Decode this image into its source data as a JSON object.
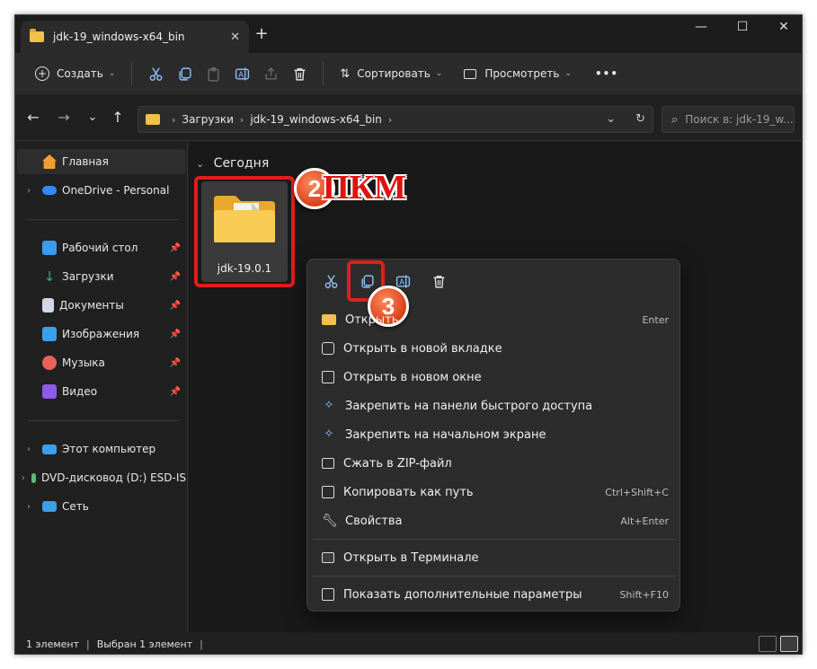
{
  "tab": {
    "title": "jdk-19_windows-x64_bin",
    "close": "✕",
    "new_tab": "+"
  },
  "window_controls": {
    "minimize": "—",
    "maximize": "☐",
    "close": "✕"
  },
  "toolbar": {
    "create_label": "Создать",
    "sort_label": "Сортировать",
    "view_label": "Просмотреть",
    "more": "•••"
  },
  "nav": {
    "back": "←",
    "forward": "→",
    "recent": "⌄",
    "up": "↑"
  },
  "address": {
    "crumbs": [
      "Загрузки",
      "jdk-19_windows-x64_bin"
    ],
    "separator": "›"
  },
  "search": {
    "placeholder": "Поиск в: jdk-19_w..."
  },
  "sidebar": {
    "items": [
      {
        "label": "Главная",
        "icon": "home-icon",
        "color": "#f0a030"
      },
      {
        "label": "OneDrive - Personal",
        "icon": "onedrive-icon",
        "color": "#2f8cff"
      },
      {
        "label": "Рабочий стол",
        "icon": "desktop-icon",
        "color": "#3a9cf0"
      },
      {
        "label": "Загрузки",
        "icon": "download-icon",
        "color": "#36b37e"
      },
      {
        "label": "Документы",
        "icon": "documents-icon",
        "color": "#cfd8e3"
      },
      {
        "label": "Изображения",
        "icon": "pictures-icon",
        "color": "#3aa0e8"
      },
      {
        "label": "Музыка",
        "icon": "music-icon",
        "color": "#e8625a"
      },
      {
        "label": "Видео",
        "icon": "video-icon",
        "color": "#8e5ae8"
      },
      {
        "label": "Этот компьютер",
        "icon": "computer-icon",
        "color": "#3aa0e8"
      },
      {
        "label": "DVD-дисковод (D:) ESD-IS",
        "icon": "dvd-icon",
        "color": "#5fb878"
      },
      {
        "label": "Сеть",
        "icon": "network-icon",
        "color": "#3aa0e8"
      }
    ]
  },
  "content": {
    "group_header": "Сегодня",
    "file_name": "jdk-19.0.1",
    "annotation_text": "ПКМ",
    "step2": "2",
    "step3": "3"
  },
  "context_menu": {
    "items": [
      {
        "label": "Открыть",
        "shortcut": "Enter",
        "icon": "folder-open-icon"
      },
      {
        "label": "Открыть в новой вкладке",
        "shortcut": "",
        "icon": "new-tab-icon"
      },
      {
        "label": "Открыть в новом окне",
        "shortcut": "",
        "icon": "new-window-icon"
      },
      {
        "label": "Закрепить на панели быстрого доступа",
        "shortcut": "",
        "icon": "pin-icon"
      },
      {
        "label": "Закрепить на начальном экране",
        "shortcut": "",
        "icon": "pin-start-icon"
      },
      {
        "label": "Сжать в ZIP-файл",
        "shortcut": "",
        "icon": "zip-icon"
      },
      {
        "label": "Копировать как путь",
        "shortcut": "Ctrl+Shift+C",
        "icon": "copy-path-icon"
      },
      {
        "label": "Свойства",
        "shortcut": "Alt+Enter",
        "icon": "wrench-icon"
      },
      {
        "label": "Открыть в Терминале",
        "shortcut": "",
        "icon": "terminal-icon"
      },
      {
        "label": "Показать дополнительные параметры",
        "shortcut": "Shift+F10",
        "icon": "more-options-icon"
      }
    ]
  },
  "status": {
    "count": "1 элемент",
    "selected": "Выбран 1 элемент"
  },
  "colors": {
    "accent": "#4cc2ff",
    "highlight_red": "#e01e1e",
    "badge_orange": "#e0521f"
  }
}
